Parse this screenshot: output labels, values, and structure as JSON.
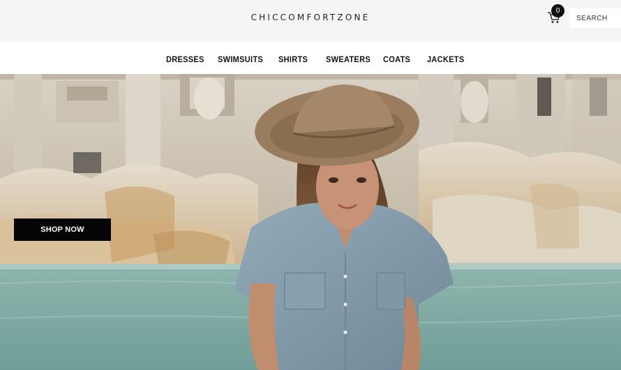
{
  "header": {
    "brand": "CHICCOMFORTZONE",
    "cart_count": "0",
    "search_placeholder": "SEARCH"
  },
  "nav": {
    "items": [
      "DRESSES",
      "SWIMSUITS",
      "SHIRTS",
      "SWEATERS",
      "COATS",
      "JACKETS"
    ]
  },
  "hero": {
    "cta_label": "SHOP NOW"
  },
  "icons": {
    "cart": "shopping-cart-icon"
  },
  "colors": {
    "topbar": "#f5f5f5",
    "button": "#050505",
    "badge": "#111111",
    "water": "#7fa9a3"
  }
}
